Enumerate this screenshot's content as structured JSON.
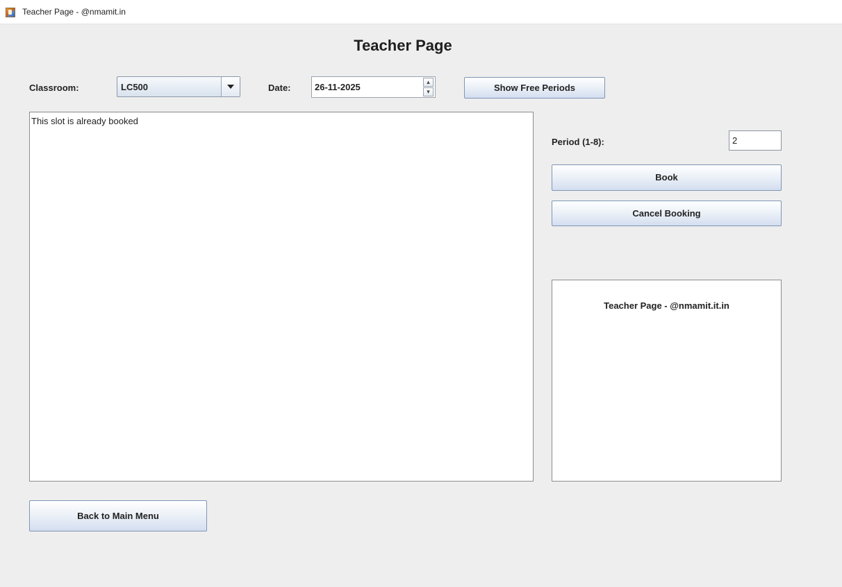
{
  "window": {
    "title": "Teacher Page - @nmamit.in",
    "icon": "java-app-icon"
  },
  "header": {
    "title": "Teacher Page"
  },
  "toolbar": {
    "classroom_label": "Classroom:",
    "classroom_value": "LC500",
    "date_label": "Date:",
    "date_value": "26-11-2025",
    "spin_up": "▴",
    "spin_down": "▾",
    "show_free_periods_label": "Show Free Periods"
  },
  "output": {
    "text": "This slot is already booked"
  },
  "booking": {
    "period_label": "Period (1-8):",
    "period_value": "2",
    "book_label": "Book",
    "cancel_label": "Cancel Booking"
  },
  "info_panel": {
    "text": "Teacher Page - @nmamit.it.in"
  },
  "footer": {
    "back_label": "Back to Main Menu"
  },
  "colors": {
    "background": "#eeeeee",
    "button_border": "#7f95b4",
    "button_gradient_bottom": "#d4def0"
  }
}
